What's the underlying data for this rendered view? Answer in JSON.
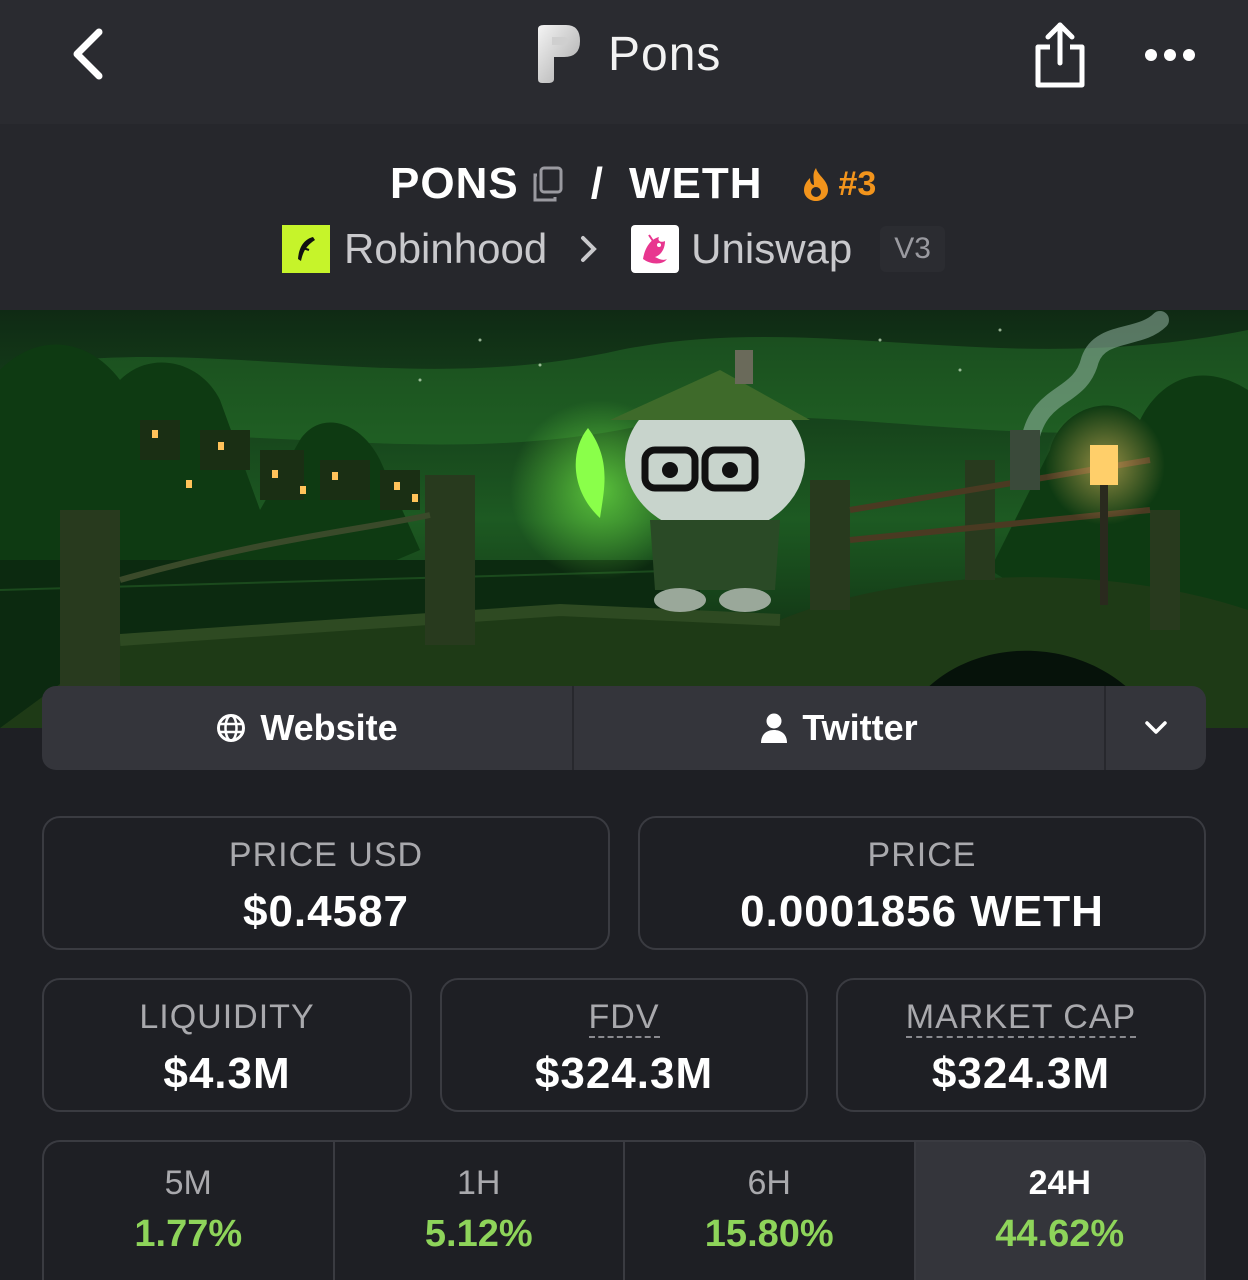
{
  "header": {
    "title": "Pons"
  },
  "pair": {
    "base": "PONS",
    "separator": "/",
    "quote": "WETH",
    "rank": "#3",
    "chain": "Robinhood",
    "dex": "Uniswap",
    "version": "V3"
  },
  "links": {
    "website": "Website",
    "twitter": "Twitter"
  },
  "stats": {
    "price_usd": {
      "label": "PRICE USD",
      "value": "$0.4587"
    },
    "price": {
      "label": "PRICE",
      "value": "0.0001856 WETH"
    },
    "liquidity": {
      "label": "LIQUIDITY",
      "value": "$4.3M"
    },
    "fdv": {
      "label": "FDV",
      "value": "$324.3M"
    },
    "market_cap": {
      "label": "MARKET CAP",
      "value": "$324.3M"
    }
  },
  "timeframes": [
    {
      "label": "5M",
      "change": "1.77%"
    },
    {
      "label": "1H",
      "change": "5.12%"
    },
    {
      "label": "6H",
      "change": "15.80%"
    },
    {
      "label": "24H",
      "change": "44.62%"
    }
  ],
  "colors": {
    "positive": "#8ed45a",
    "rank": "#f2941c",
    "chain_brand": "#c6f42a"
  }
}
